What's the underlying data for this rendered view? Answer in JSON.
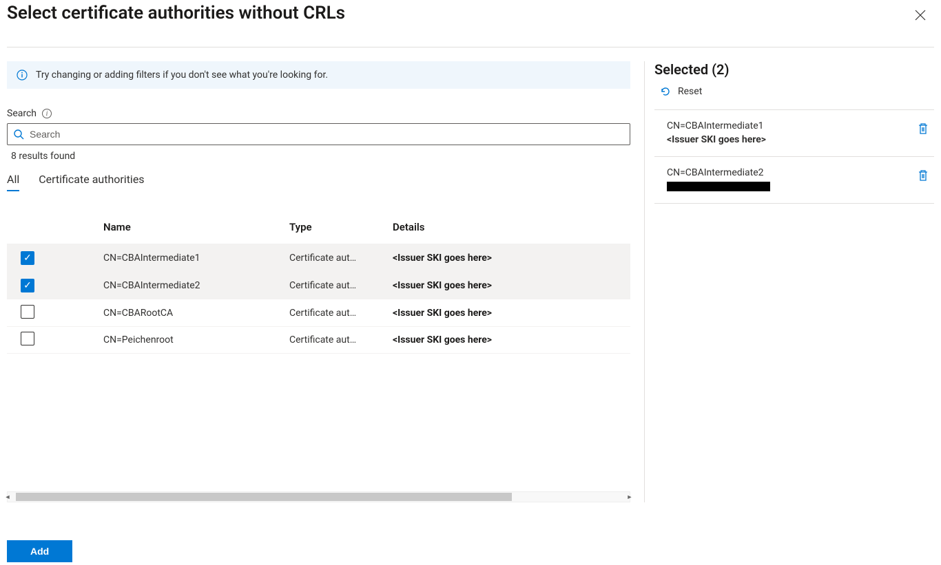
{
  "header": {
    "title": "Select certificate authorities without CRLs"
  },
  "banner": {
    "text": "Try changing or adding filters if you don't see what you're looking for."
  },
  "search": {
    "label": "Search",
    "placeholder": "Search",
    "results": "8 results found"
  },
  "tabs": {
    "all": "All",
    "ca": "Certificate authorities"
  },
  "table": {
    "columns": {
      "name": "Name",
      "type": "Type",
      "details": "Details"
    },
    "rows": [
      {
        "checked": true,
        "name": "CN=CBAIntermediate1",
        "type": "Certificate aut…",
        "details": "<Issuer SKI goes here>"
      },
      {
        "checked": true,
        "name": "CN=CBAIntermediate2",
        "type": "Certificate aut…",
        "details": "<Issuer SKI goes here>"
      },
      {
        "checked": false,
        "name": "CN=CBARootCA",
        "type": "Certificate aut…",
        "details": "<Issuer SKI goes here>"
      },
      {
        "checked": false,
        "name": "CN=Peichenroot",
        "type": "Certificate aut…",
        "details": "<Issuer SKI goes here>"
      }
    ]
  },
  "selected": {
    "heading": "Selected (2)",
    "reset": "Reset",
    "items": [
      {
        "name": "CN=CBAIntermediate1",
        "sub": "<Issuer SKI goes here>",
        "redacted": false
      },
      {
        "name": "CN=CBAIntermediate2",
        "sub": "",
        "redacted": true
      }
    ]
  },
  "footer": {
    "add": "Add"
  }
}
